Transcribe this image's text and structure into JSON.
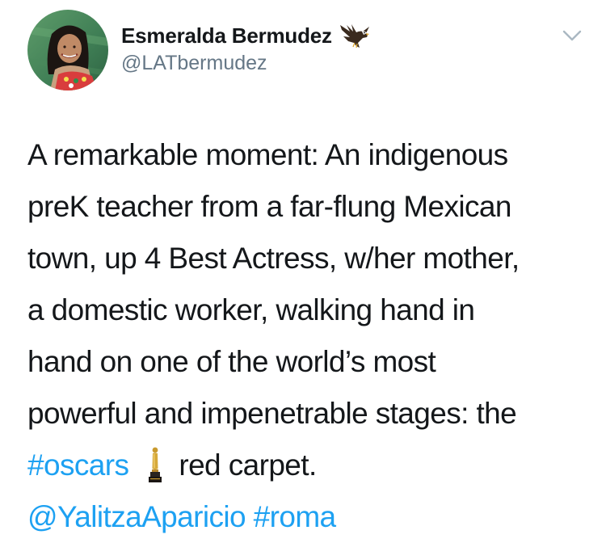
{
  "user": {
    "display_name": "Esmeralda Bermudez",
    "handle": "@LATbermudez",
    "name_emoji": "eagle-icon"
  },
  "menu": {
    "icon": "chevron-down-icon"
  },
  "tweet": {
    "lines": [
      "A remarkable moment: An indigenous",
      "preK teacher from a far-flung Mexican",
      "town, up 4 Best Actress, w/her mother,",
      "a domestic worker, walking hand in",
      "hand on one of the world’s most",
      "powerful and impenetrable stages: the"
    ],
    "hashtag_oscars": "#oscars",
    "oscar_emoji": "oscar-statuette-icon",
    "after_oscar": "red carpet.",
    "mention": "@YalitzaAparicio",
    "hashtag_roma": "#roma"
  },
  "colors": {
    "text": "#14171a",
    "secondary": "#657786",
    "link": "#1da1f2"
  }
}
